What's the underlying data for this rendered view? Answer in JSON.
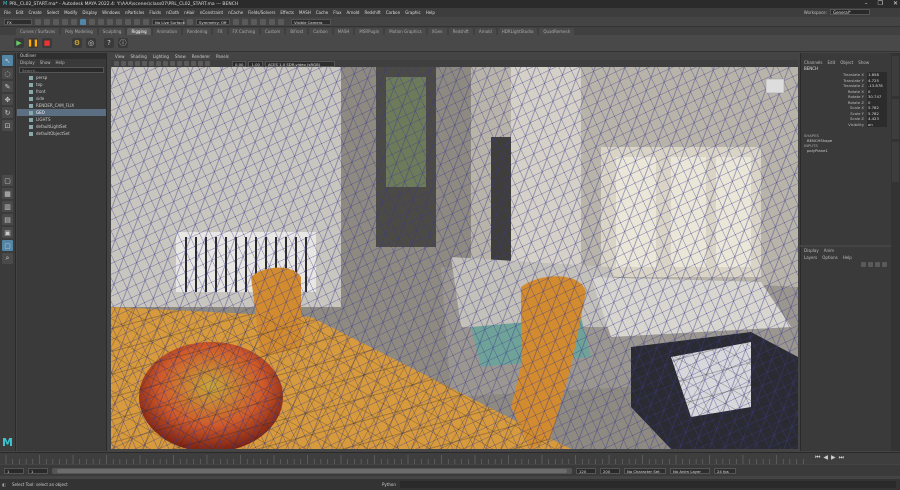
{
  "window": {
    "title": "PRL_CL02_START.ma* - Autodesk MAYA 2022.4: Y:\\AAA\\scenes\\class07\\PRL_CL02_START.ma   ---   BENCH",
    "controls": [
      "–",
      "❐",
      "✕"
    ]
  },
  "menubar": {
    "items": [
      "File",
      "Edit",
      "Create",
      "Select",
      "Modify",
      "Display",
      "Windows",
      "nParticles",
      "Fluids",
      "nCloth",
      "nHair",
      "nConstraint",
      "nCache",
      "Fields/Solvers",
      "Effects",
      "MASH",
      "Cache",
      "Flux",
      "Arnold",
      "Redshift",
      "Carbon",
      "Graphic",
      "Help"
    ],
    "workspace_label": "Workspace:",
    "workspace_value": "General*"
  },
  "statusline": {
    "mode": "FX",
    "no_live_surface": "No Live Surface",
    "symmetry": "Symmetry: Off",
    "camera": "Visible Camera"
  },
  "shelf": {
    "tabs": [
      "Curves / Surfaces",
      "Poly Modeling",
      "Sculpting",
      "Rigging",
      "Animation",
      "Rendering",
      "FX",
      "FX Caching",
      "Custom",
      "Bifrost",
      "Carbon",
      "MASH",
      "MSRPugin",
      "Motion Graphics",
      "XGen",
      "Redshift",
      "Arnold",
      "HDRLightStudio",
      "QuadRemesh"
    ],
    "active_tab": "Rigging"
  },
  "outliner": {
    "title": "Outliner",
    "menu": [
      "Display",
      "Show",
      "Help"
    ],
    "search_placeholder": "Search...",
    "items": [
      "persp",
      "top",
      "front",
      "side",
      "RENDER_CAM_FLIX",
      "GEO",
      "LIGHTS",
      "defaultLightSet",
      "defaultObjectSet"
    ],
    "selected_index": 5
  },
  "viewport": {
    "menu": [
      "View",
      "Shading",
      "Lighting",
      "Show",
      "Renderer",
      "Panels"
    ],
    "field1": "0.00",
    "field2": "1.00",
    "colorspace": "ACES 1.0 SDR-video (sRGB)"
  },
  "channelbox": {
    "tabs": [
      "Channels",
      "Edit",
      "Object",
      "Show"
    ],
    "object": "BENCH",
    "attributes": [
      {
        "name": "Translate X",
        "value": "1.658"
      },
      {
        "name": "Translate Y",
        "value": "4.725"
      },
      {
        "name": "Translate Z",
        "value": "-13.878"
      },
      {
        "name": "Rotate X",
        "value": "0"
      },
      {
        "name": "Rotate Y",
        "value": "30.747"
      },
      {
        "name": "Rotate Z",
        "value": "0"
      },
      {
        "name": "Scale X",
        "value": "5.782"
      },
      {
        "name": "Scale Y",
        "value": "5.782"
      },
      {
        "name": "Scale Z",
        "value": "4.423"
      },
      {
        "name": "Visibility",
        "value": "on"
      }
    ],
    "shapes_label": "SHAPES",
    "shape": "BENCHShape",
    "inputs_label": "INPUTS",
    "input": "polyPlane1"
  },
  "layers": {
    "tabs": [
      "Display",
      "Anim"
    ],
    "menu": [
      "Layers",
      "Options",
      "Help"
    ]
  },
  "timeline": {
    "start": "1",
    "range_start": "1",
    "range_end": "120",
    "end": "120",
    "max": "200",
    "current": "1",
    "character_set": "No Character Set",
    "anim_layer": "No Anim Layer",
    "fps": "24 fps"
  },
  "commandline": {
    "lang": "Python",
    "help": "Select Tool: select an object"
  }
}
